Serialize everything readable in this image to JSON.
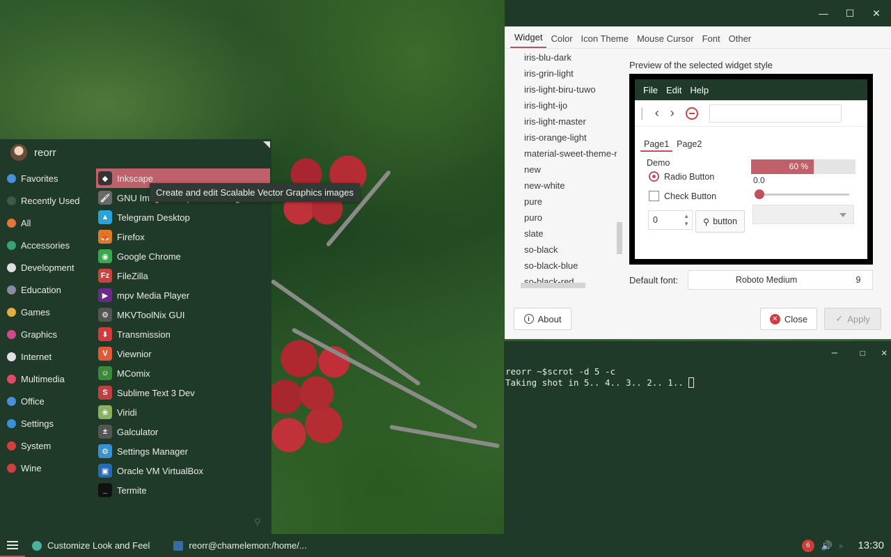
{
  "menu": {
    "username": "reorr",
    "categories": [
      {
        "label": "Favorites",
        "icon": "star-icon",
        "color": "#4a90d9"
      },
      {
        "label": "Recently Used",
        "icon": "clock-icon",
        "color": "#3d5a46"
      },
      {
        "label": "All",
        "icon": "folder-icon",
        "color": "#e07a3a"
      },
      {
        "label": "Accessories",
        "icon": "accessories-icon",
        "color": "#3aa07a"
      },
      {
        "label": "Development",
        "icon": "development-icon",
        "color": "#e0e0e0"
      },
      {
        "label": "Education",
        "icon": "education-icon",
        "color": "#8a8aa0"
      },
      {
        "label": "Games",
        "icon": "games-icon",
        "color": "#e0b040"
      },
      {
        "label": "Graphics",
        "icon": "graphics-icon",
        "color": "#d04a8a"
      },
      {
        "label": "Internet",
        "icon": "internet-icon",
        "color": "#e0e0e0"
      },
      {
        "label": "Multimedia",
        "icon": "multimedia-icon",
        "color": "#e04a6a"
      },
      {
        "label": "Office",
        "icon": "office-icon",
        "color": "#4a90d9"
      },
      {
        "label": "Settings",
        "icon": "settings-icon",
        "color": "#3a90d0"
      },
      {
        "label": "System",
        "icon": "system-icon",
        "color": "#d04040"
      },
      {
        "label": "Wine",
        "icon": "wine-icon",
        "color": "#d04040"
      }
    ],
    "apps": [
      {
        "label": "Inkscape",
        "icon": "inkscape-icon",
        "color": "#333333",
        "glyph": "◆"
      },
      {
        "label": "GNU Image Manipulation Program",
        "icon": "gimp-icon",
        "color": "#6a6a6a",
        "glyph": "🖌"
      },
      {
        "label": "Telegram Desktop",
        "icon": "telegram-icon",
        "color": "#2aa3d8",
        "glyph": "▲"
      },
      {
        "label": "Firefox",
        "icon": "firefox-icon",
        "color": "#e0782a",
        "glyph": "🦊"
      },
      {
        "label": "Google Chrome",
        "icon": "chrome-icon",
        "color": "#3aa74a",
        "glyph": "◉"
      },
      {
        "label": "FileZilla",
        "icon": "filezilla-icon",
        "color": "#d04040",
        "glyph": "Fz"
      },
      {
        "label": "mpv Media Player",
        "icon": "mpv-icon",
        "color": "#6a2a8a",
        "glyph": "▶"
      },
      {
        "label": "MKVToolNix GUI",
        "icon": "mkvtoolnix-icon",
        "color": "#555555",
        "glyph": "⚙"
      },
      {
        "label": "Transmission",
        "icon": "transmission-icon",
        "color": "#d03b3b",
        "glyph": "⬇"
      },
      {
        "label": "Viewnior",
        "icon": "viewnior-icon",
        "color": "#e05a3a",
        "glyph": "V"
      },
      {
        "label": "MComix",
        "icon": "mcomix-icon",
        "color": "#3a8a3a",
        "glyph": "☺"
      },
      {
        "label": "Sublime Text 3 Dev",
        "icon": "sublime-icon",
        "color": "#c04040",
        "glyph": "S"
      },
      {
        "label": "Viridi",
        "icon": "viridi-icon",
        "color": "#8ab060",
        "glyph": "❀"
      },
      {
        "label": "Galculator",
        "icon": "galculator-icon",
        "color": "#555555",
        "glyph": "±"
      },
      {
        "label": "Settings Manager",
        "icon": "settings-manager-icon",
        "color": "#3a90d0",
        "glyph": "⚙"
      },
      {
        "label": "Oracle VM VirtualBox",
        "icon": "virtualbox-icon",
        "color": "#2a6ab0",
        "glyph": "▣"
      },
      {
        "label": "Termite",
        "icon": "termite-icon",
        "color": "#111111",
        "glyph": "_"
      }
    ],
    "tooltip": "Create and edit Scalable Vector Graphics images"
  },
  "settings": {
    "tabs": [
      "Widget",
      "Color",
      "Icon Theme",
      "Mouse Cursor",
      "Font",
      "Other"
    ],
    "themes": [
      "iris-blu-dark",
      "iris-grin-light",
      "iris-light-biru-tuwo",
      "iris-light-ijo",
      "iris-light-master",
      "iris-orange-light",
      "material-sweet-theme-r",
      "new",
      "new-white",
      "pure",
      "puro",
      "slate",
      "so-black",
      "so-black-blue",
      "so-black-red"
    ],
    "preview_title": "Preview of the selected widget style",
    "preview": {
      "menu": [
        "File",
        "Edit",
        "Help"
      ],
      "page_tabs": [
        "Page1",
        "Page2"
      ],
      "demo_label": "Demo",
      "radio_label": "Radio Button",
      "check_label": "Check Button",
      "spin_value": "0",
      "button_label": "button",
      "progress_text": "60 %",
      "progress_fraction": 0.6,
      "scale_value": "0.0"
    },
    "default_font_label": "Default font:",
    "font_name": "Roboto Medium",
    "font_size": "9",
    "about_label": "About",
    "close_label": "Close",
    "apply_label": "Apply"
  },
  "terminal": {
    "line1": "reorr ~$scrot -d 5 -c",
    "line2": "Taking shot in 5.. 4.. 3.. 2.. 1.. "
  },
  "taskbar": {
    "tasks": [
      {
        "label": "Customize Look and Feel",
        "color": "#4ab0a0"
      },
      {
        "label": "reorr@chamelemon:/home/...",
        "color": "#3a6aa0"
      }
    ],
    "badge": "6",
    "clock": "13:30"
  }
}
